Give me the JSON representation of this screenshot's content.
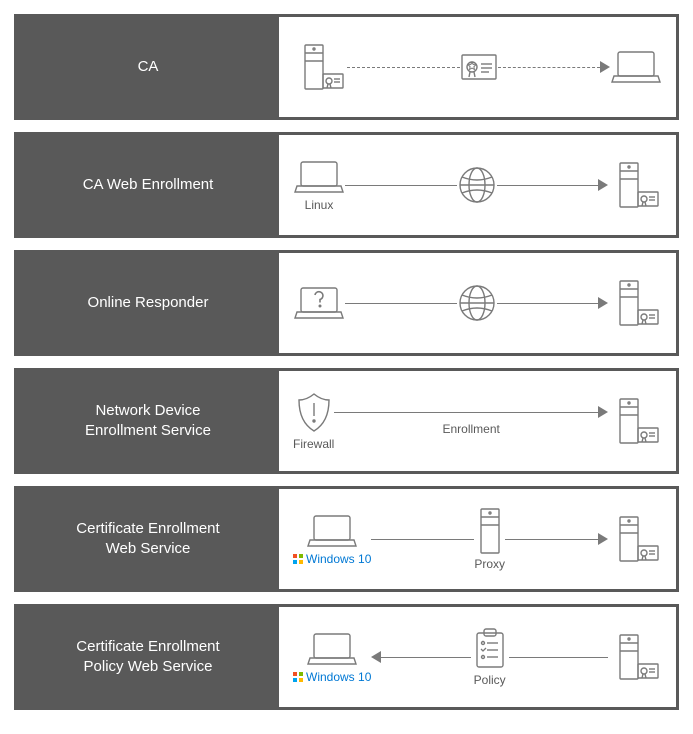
{
  "rows": [
    {
      "id": "ca",
      "label": "CA"
    },
    {
      "id": "caweb",
      "label": "CA Web Enrollment",
      "linuxLabel": "Linux"
    },
    {
      "id": "responder",
      "label": "Online Responder"
    },
    {
      "id": "ndes",
      "label": "Network Device\nEnrollment Service",
      "firewallLabel": "Firewall",
      "midLabel": "Enrollment"
    },
    {
      "id": "cews",
      "label": "Certificate Enrollment\nWeb Service",
      "winLabel": "Windows 10",
      "proxyLabel": "Proxy"
    },
    {
      "id": "cepws",
      "label": "Certificate Enrollment\nPolicy Web Service",
      "winLabel": "Windows 10",
      "policyLabel": "Policy"
    }
  ]
}
